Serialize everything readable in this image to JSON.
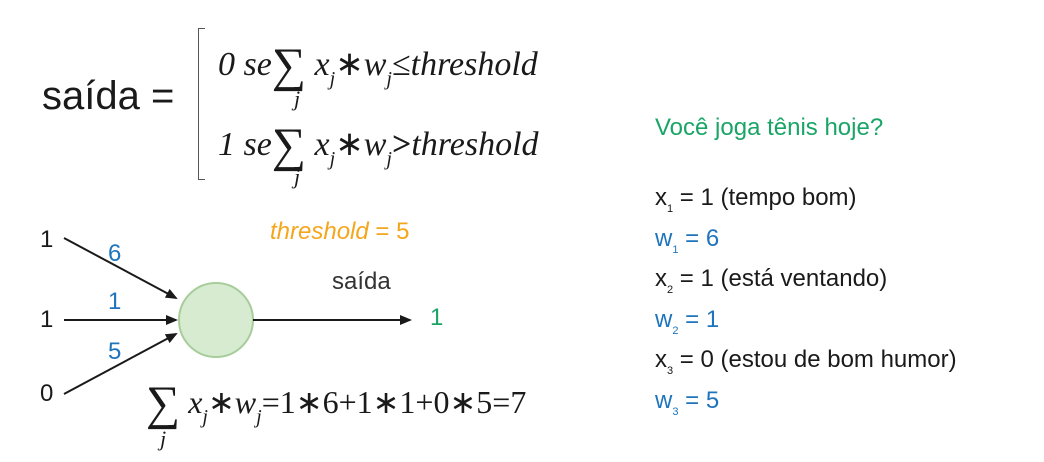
{
  "formula": {
    "output_label": "saída =",
    "case0": {
      "value": "0",
      "word": "se",
      "sum": "∑",
      "x": "x",
      "j": "j",
      "times": "∗",
      "w": "w",
      "relation": "≤",
      "threshold": "threshold",
      "index": "j"
    },
    "case1": {
      "value": "1",
      "word": "se",
      "sum": "∑",
      "x": "x",
      "j": "j",
      "times": "∗",
      "w": "w",
      "relation": ">",
      "threshold": "threshold",
      "index": "j"
    }
  },
  "neuron": {
    "threshold_label": "threshold",
    "threshold_value": "= 5",
    "output_label": "saída",
    "output_value": "1",
    "inputs": [
      "1",
      "1",
      "0"
    ],
    "weights": [
      "6",
      "1",
      "5"
    ],
    "accent_green": "#1aa566",
    "accent_blue": "#1f74bd",
    "accent_orange": "#f4a61d",
    "node_fill": "#d6ebcf",
    "node_stroke": "#a6cd9a"
  },
  "sum_equation": {
    "sum": "∑",
    "x": "x",
    "j": "j",
    "times": "∗",
    "w": "w",
    "rhs": "=1∗6+1∗1+0∗5=7",
    "index": "j"
  },
  "example": {
    "question": "Você joga tênis hoje?",
    "rows": [
      {
        "var": "x",
        "sub": "1",
        "text": " = 1 (tempo bom)",
        "color": "#1a1a1a"
      },
      {
        "var": "w",
        "sub": "1",
        "text": " = 6",
        "color": "#1f74bd"
      },
      {
        "var": "x",
        "sub": "2",
        "text": " = 1 (está ventando)",
        "color": "#1a1a1a"
      },
      {
        "var": "w",
        "sub": "2",
        "text": " = 1",
        "color": "#1f74bd"
      },
      {
        "var": "x",
        "sub": "3",
        "text": " = 0 (estou de bom humor)",
        "color": "#1a1a1a"
      },
      {
        "var": "w",
        "sub": "3",
        "text": " = 5",
        "color": "#1f74bd"
      }
    ]
  }
}
